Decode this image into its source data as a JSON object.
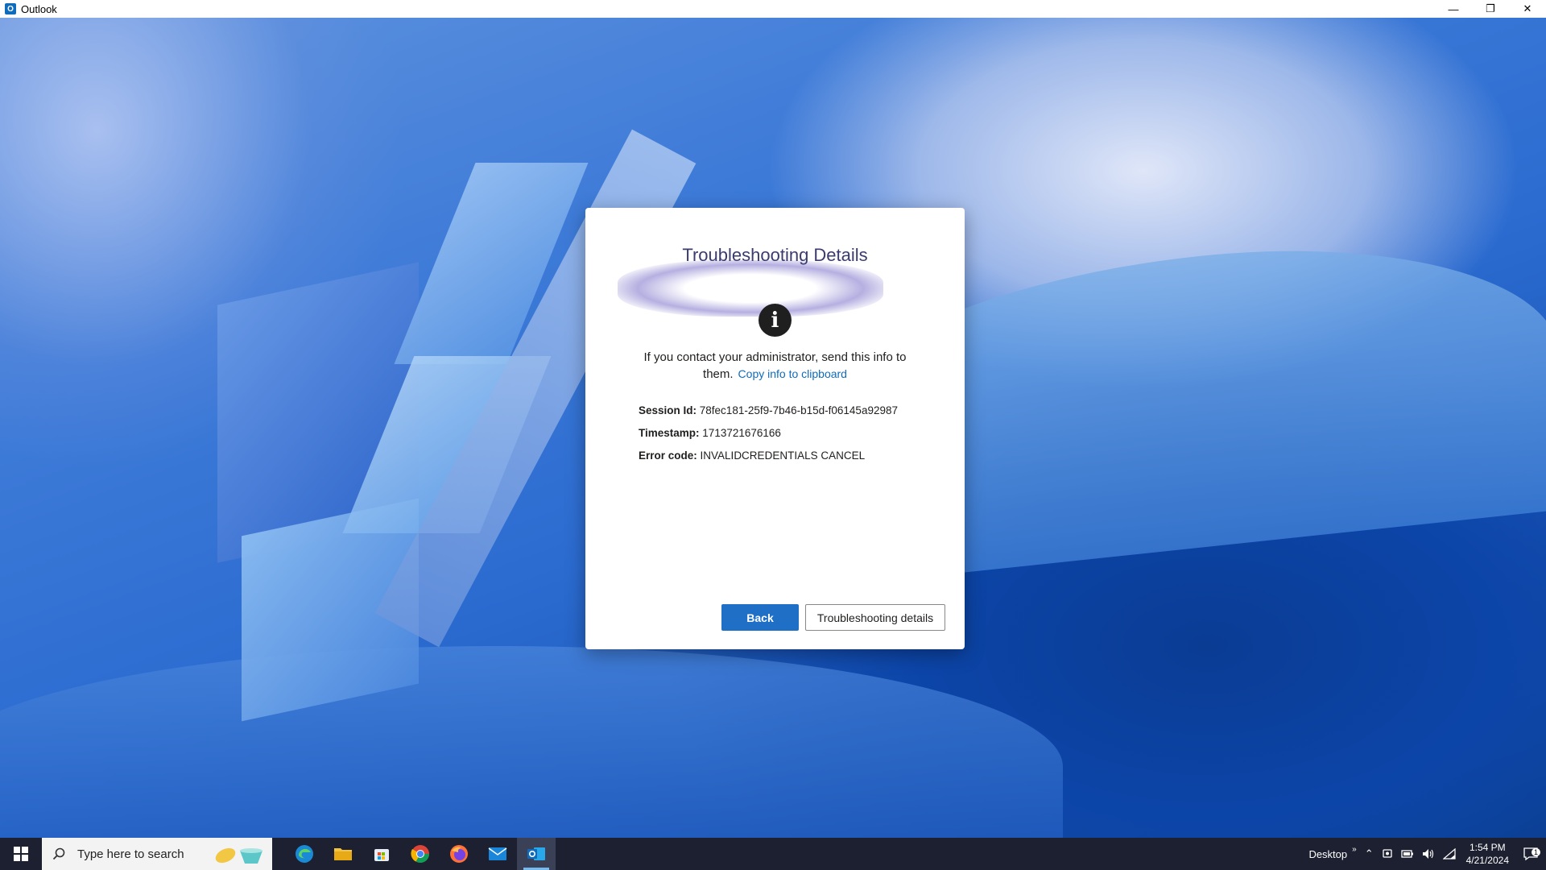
{
  "window": {
    "title": "Outlook",
    "app_icon_letter": "O",
    "minimize_glyph": "—",
    "restore_glyph": "❐",
    "close_glyph": "✕"
  },
  "dialog": {
    "title": "Troubleshooting Details",
    "info_glyph": "i",
    "message": "If you contact your administrator, send this info to them.",
    "copy_link": "Copy info to clipboard",
    "fields": {
      "session_label": "Session Id:",
      "session_value": "78fec181-25f9-7b46-b15d-f06145a92987",
      "timestamp_label": "Timestamp:",
      "timestamp_value": "1713721676166",
      "error_label": "Error code:",
      "error_value": "INVALIDCREDENTIALS CANCEL"
    },
    "buttons": {
      "back": "Back",
      "troubleshooting": "Troubleshooting details"
    }
  },
  "taskbar": {
    "search_placeholder": "Type here to search",
    "apps": [
      {
        "name": "edge-icon",
        "glyph": "e",
        "color": "#35c1e8"
      },
      {
        "name": "file-explorer-icon",
        "glyph": "▬",
        "color": "#f4c542"
      },
      {
        "name": "store-icon",
        "glyph": "▦",
        "color": "#5ba3e6"
      },
      {
        "name": "chrome-icon",
        "glyph": "◉",
        "color": "#e94235"
      },
      {
        "name": "firefox-icon",
        "glyph": "●",
        "color": "#ff7139"
      },
      {
        "name": "mail-icon",
        "glyph": "✉",
        "color": "#1a86d9"
      },
      {
        "name": "outlook-icon",
        "glyph": "O",
        "color": "#0f6cbd"
      }
    ],
    "tray": {
      "desktop_label": "Desktop",
      "chevron": "»",
      "up_arrow": "⌃",
      "time": "1:54 PM",
      "date": "4/21/2024",
      "notification_count": "1"
    }
  },
  "colors": {
    "accent": "#0f6cbd",
    "back_button": "#1f6fc6",
    "taskbar": "#1c2030"
  }
}
